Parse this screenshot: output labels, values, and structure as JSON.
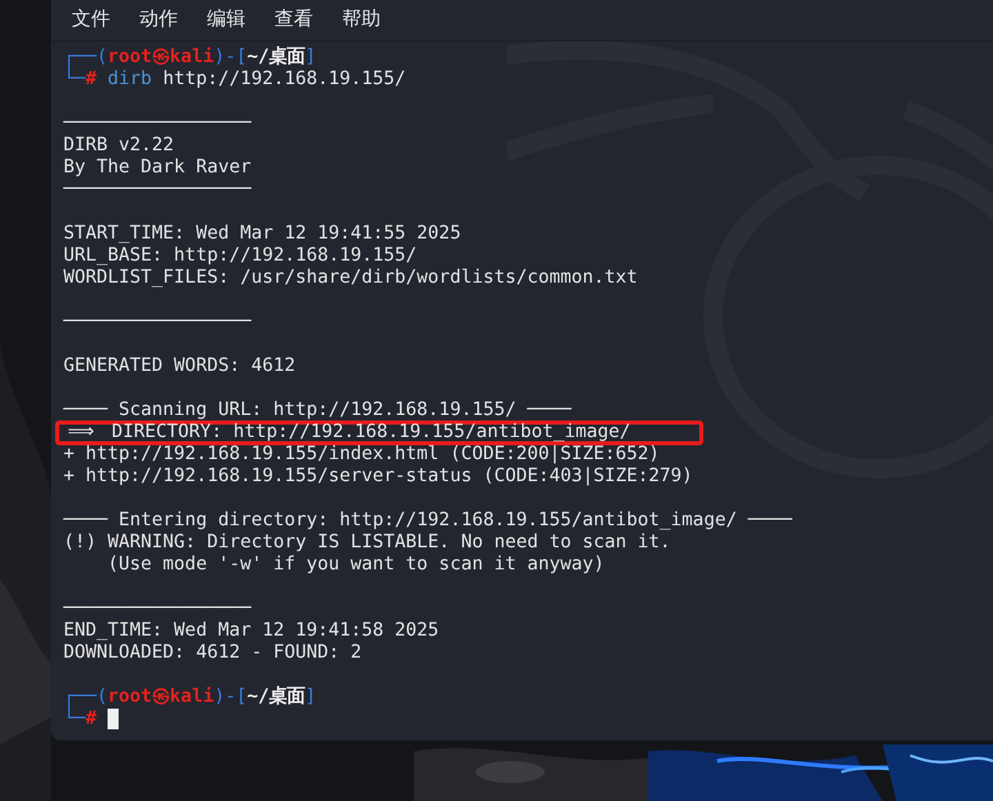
{
  "menu": [
    {
      "label": "文件"
    },
    {
      "label": "动作"
    },
    {
      "label": "编辑"
    },
    {
      "label": "查看"
    },
    {
      "label": "帮助"
    }
  ],
  "lines": [
    {
      "kind": "prompt",
      "segments": [
        {
          "kind": "bracket",
          "text": "┌──("
        },
        {
          "kind": "user",
          "text": "root㉿kali"
        },
        {
          "kind": "bracket",
          "text": ")-["
        },
        {
          "kind": "path",
          "text": "~/桌面"
        },
        {
          "kind": "bracket",
          "text": "]"
        }
      ]
    },
    {
      "kind": "input",
      "segments": [
        {
          "kind": "bracket",
          "text": "└─"
        },
        {
          "kind": "hash",
          "text": "#"
        },
        {
          "kind": "command",
          "text": "dirb"
        },
        {
          "kind": "arg",
          "text": "http://192.168.19.155/"
        }
      ],
      "cursor": false
    },
    {
      "kind": "blank"
    },
    {
      "kind": "rule",
      "text": "─────────────────"
    },
    {
      "kind": "text",
      "text": "DIRB v2.22"
    },
    {
      "kind": "text",
      "text": "By The Dark Raver"
    },
    {
      "kind": "rule",
      "text": "─────────────────"
    },
    {
      "kind": "blank"
    },
    {
      "kind": "text",
      "text": "START_TIME: Wed Mar 12 19:41:55 2025"
    },
    {
      "kind": "text",
      "text": "URL_BASE: http://192.168.19.155/"
    },
    {
      "kind": "text",
      "text": "WORDLIST_FILES: /usr/share/dirb/wordlists/common.txt"
    },
    {
      "kind": "blank"
    },
    {
      "kind": "rule",
      "text": "─────────────────"
    },
    {
      "kind": "blank"
    },
    {
      "kind": "text",
      "text": "GENERATED WORDS: 4612"
    },
    {
      "kind": "blank"
    },
    {
      "kind": "text",
      "text": "──── Scanning URL: http://192.168.19.155/ ────"
    },
    {
      "kind": "arrow",
      "arrow": "⟹",
      "text": "DIRECTORY: http://192.168.19.155/antibot_image/",
      "highlighted": true
    },
    {
      "kind": "text",
      "text": "+ http://192.168.19.155/index.html (CODE:200|SIZE:652)"
    },
    {
      "kind": "text",
      "text": "+ http://192.168.19.155/server-status (CODE:403|SIZE:279)"
    },
    {
      "kind": "blank"
    },
    {
      "kind": "text",
      "text": "──── Entering directory: http://192.168.19.155/antibot_image/ ────"
    },
    {
      "kind": "text",
      "text": "(!) WARNING: Directory IS LISTABLE. No need to scan it."
    },
    {
      "kind": "text",
      "text": "    (Use mode '-w' if you want to scan it anyway)"
    },
    {
      "kind": "blank"
    },
    {
      "kind": "rule",
      "text": "─────────────────"
    },
    {
      "kind": "text",
      "text": "END_TIME: Wed Mar 12 19:41:58 2025"
    },
    {
      "kind": "text",
      "text": "DOWNLOADED: 4612 - FOUND: 2"
    },
    {
      "kind": "blank"
    },
    {
      "kind": "prompt",
      "segments": [
        {
          "kind": "bracket",
          "text": "┌──("
        },
        {
          "kind": "user",
          "text": "root㉿kali"
        },
        {
          "kind": "bracket",
          "text": ")-["
        },
        {
          "kind": "path",
          "text": "~/桌面"
        },
        {
          "kind": "bracket",
          "text": "]"
        }
      ]
    },
    {
      "kind": "input",
      "segments": [
        {
          "kind": "bracket",
          "text": "└─"
        },
        {
          "kind": "hash",
          "text": "#"
        }
      ],
      "cursor": true
    }
  ]
}
